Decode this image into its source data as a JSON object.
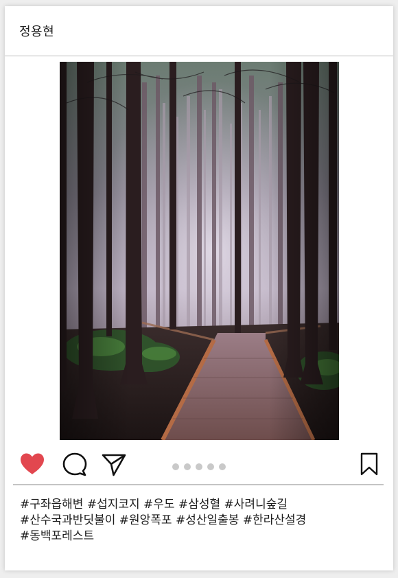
{
  "post": {
    "username": "정용현",
    "image_alt": "안개 낀 삼나무 숲 사이로 난 나무 데크 산책로",
    "caption_lines": [
      "#구좌읍해변 #섭지코지 #우도 #삼성혈 #사려니숲길",
      "#산수국과반딧불이 #원앙폭포 #성산일출봉 #한라산설경",
      "#동백포레스트"
    ],
    "carousel": {
      "count": 5,
      "active_index": 0
    }
  },
  "icons": {
    "like": "heart-filled-icon",
    "comment": "speech-bubble-icon",
    "share": "paper-plane-icon",
    "save": "bookmark-icon"
  },
  "colors": {
    "like": "#e2474f",
    "dot": "#c9c9c9",
    "divider": "#c4c4c4",
    "icon_stroke": "#111111"
  }
}
